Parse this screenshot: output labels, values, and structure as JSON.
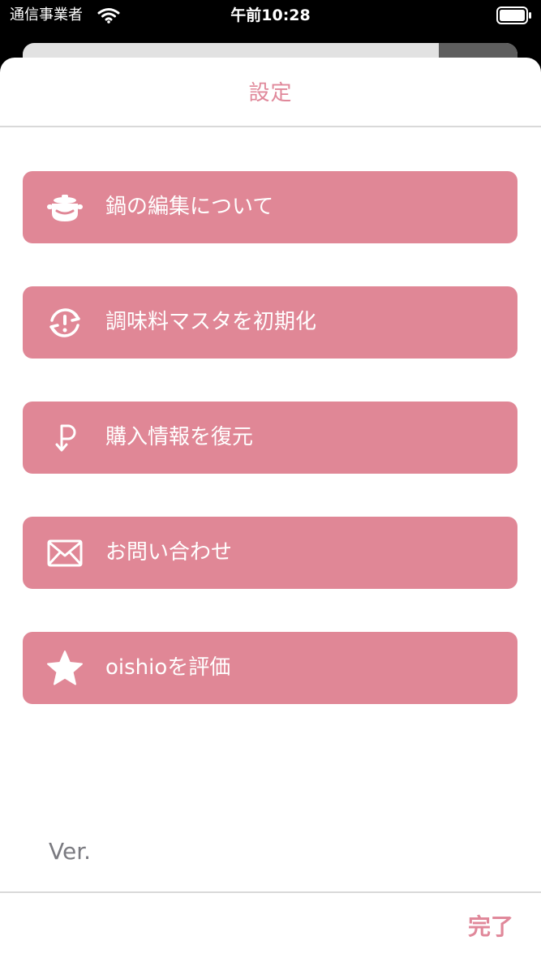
{
  "status_bar": {
    "carrier": "通信事業者",
    "time": "午前10:28"
  },
  "header": {
    "title": "設定"
  },
  "menu": [
    {
      "label": "鍋の編集について",
      "icon": "pot-icon"
    },
    {
      "label": "調味料マスタを初期化",
      "icon": "reset-icon"
    },
    {
      "label": "購入情報を復元",
      "icon": "restore-purchase-icon"
    },
    {
      "label": "お問い合わせ",
      "icon": "mail-icon"
    },
    {
      "label": "oishioを評価",
      "icon": "star-icon"
    }
  ],
  "version_label": "Ver.",
  "footer": {
    "done_label": "完了"
  },
  "colors": {
    "accent": "#e08796",
    "title_text": "#e0889a",
    "divider": "#d9d9d9",
    "version_text": "#7a7a80"
  }
}
